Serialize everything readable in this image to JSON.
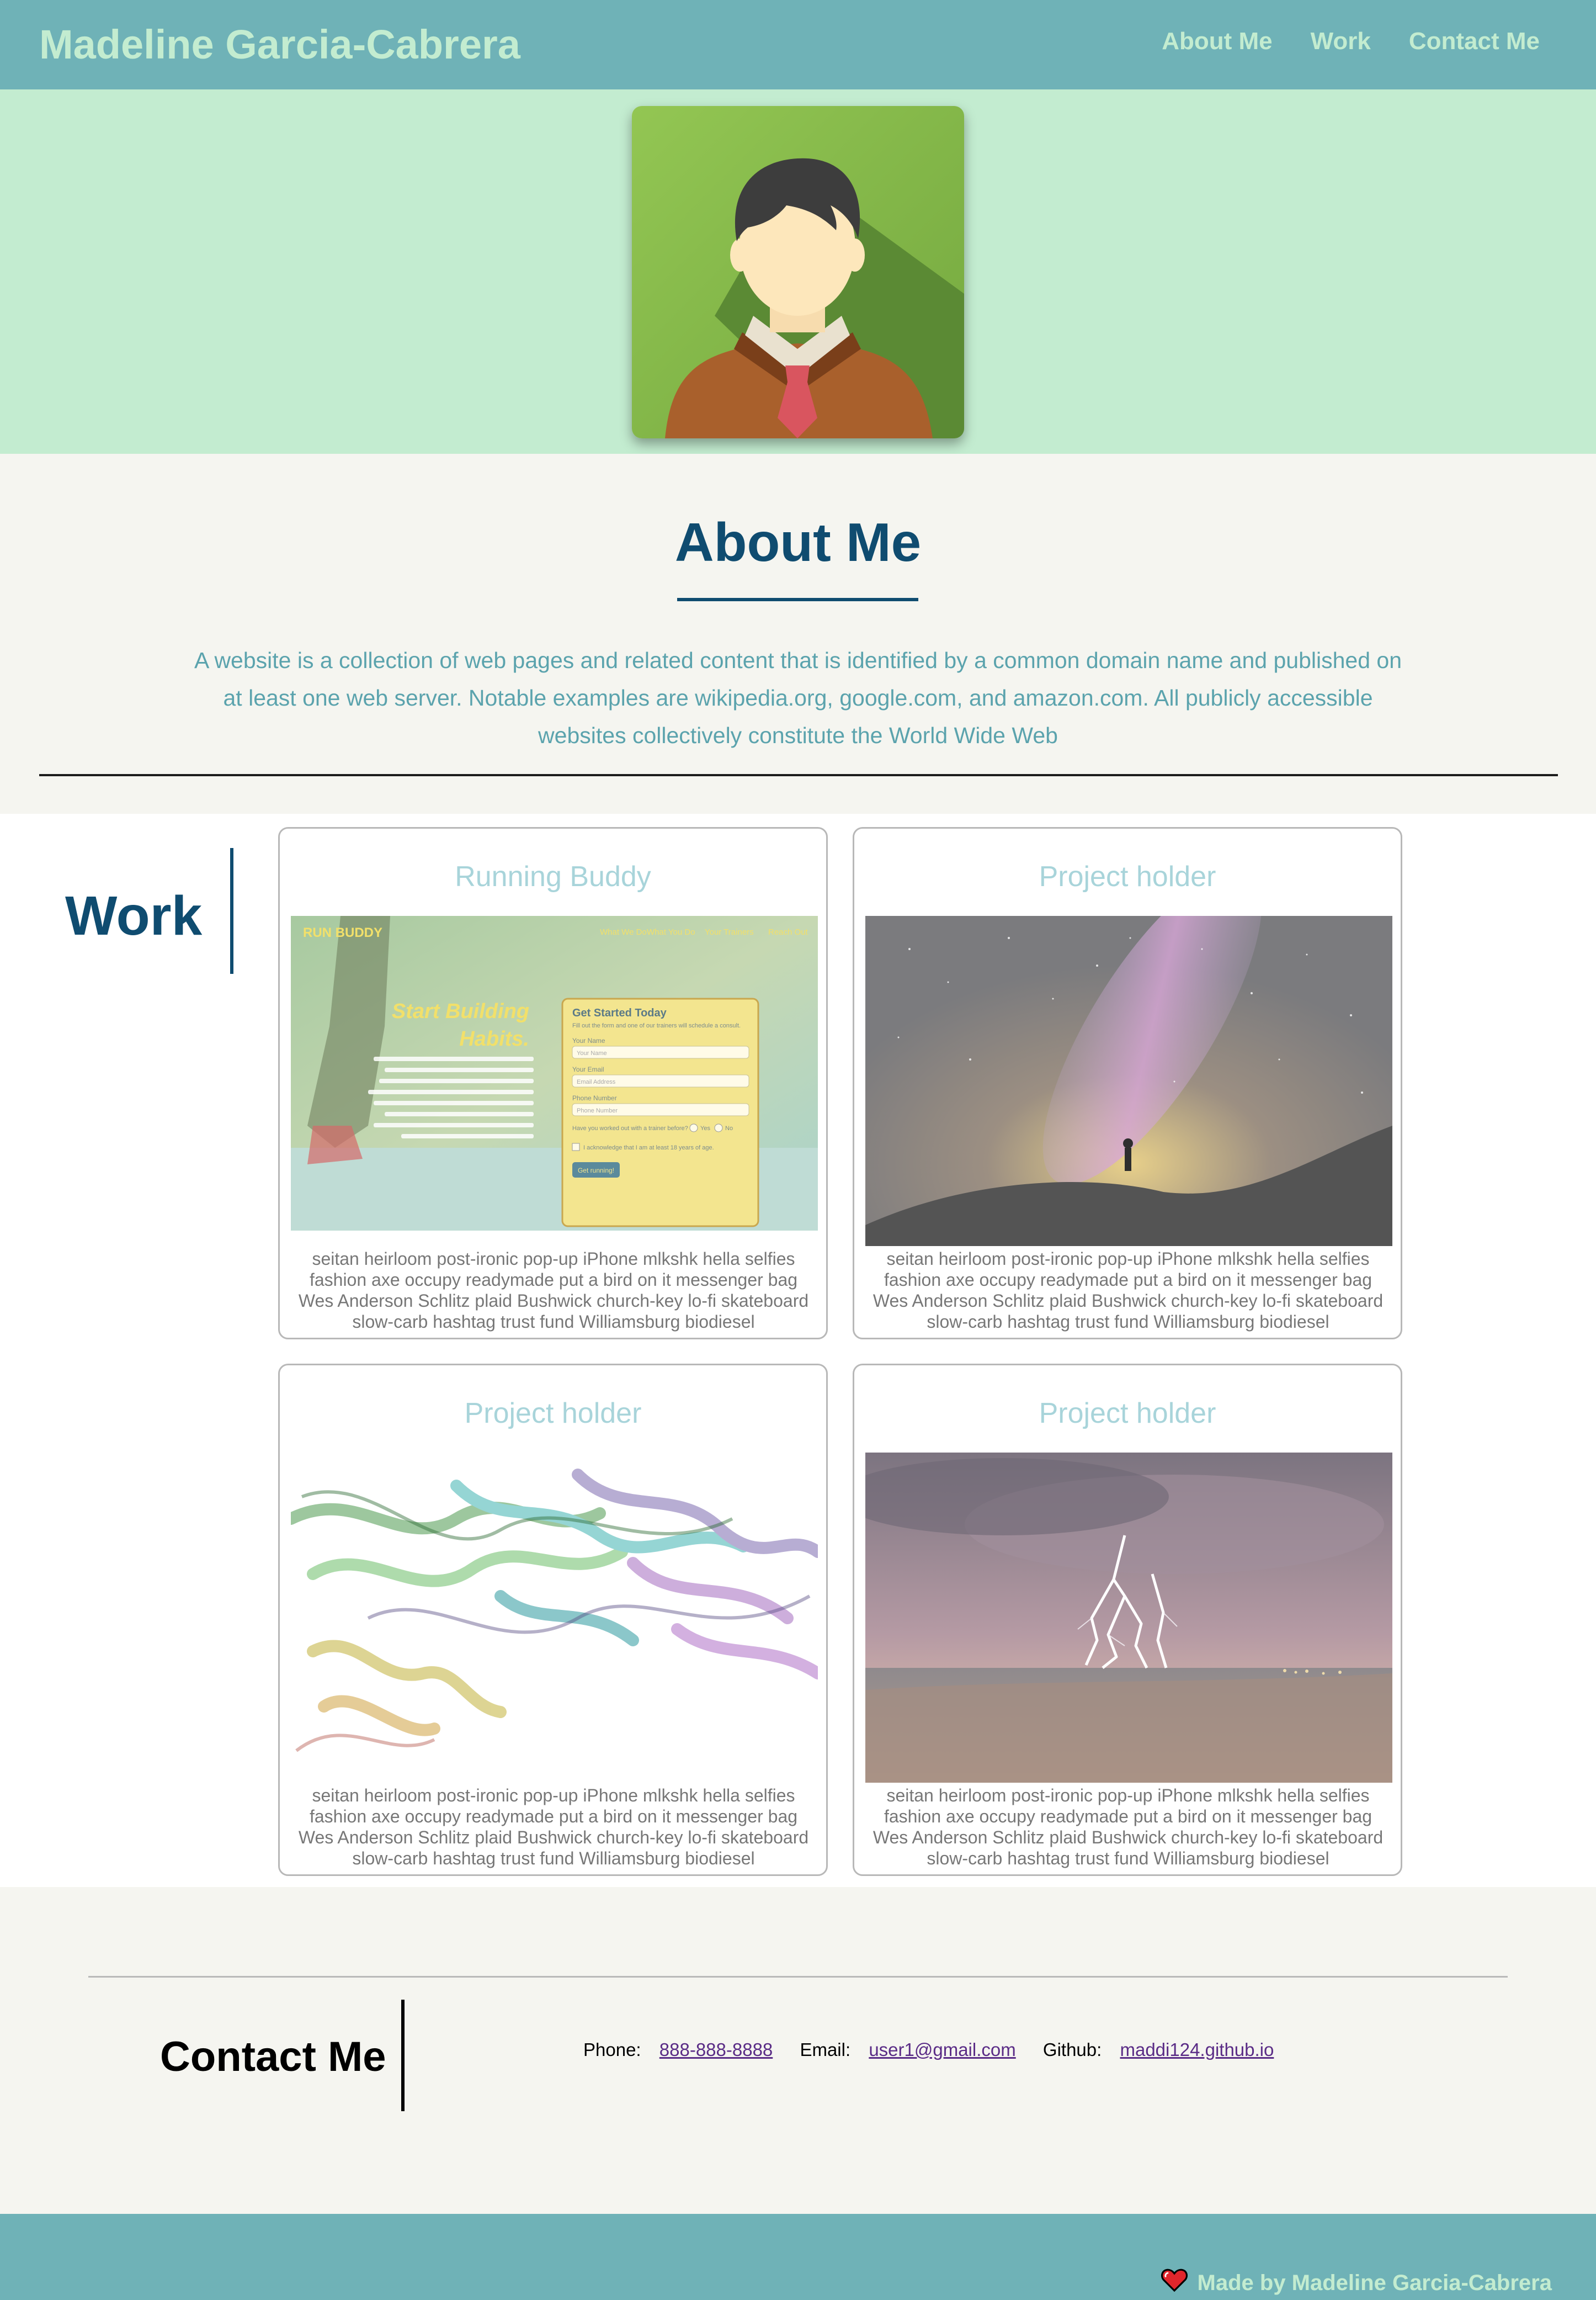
{
  "header": {
    "brand": "Madeline Garcia-Cabrera",
    "nav": [
      {
        "label": "About Me"
      },
      {
        "label": "Work"
      },
      {
        "label": "Contact Me"
      }
    ]
  },
  "about": {
    "title": "About Me",
    "text": "A website is a collection of web pages and related content that is identified by a common domain name and published on at least one web server. Notable examples are wikipedia.org, google.com, and amazon.com. All publicly accessible websites collectively constitute the World Wide Web"
  },
  "work": {
    "title": "Work",
    "cards": [
      {
        "title": "Running Buddy",
        "description": "seitan heirloom post-ironic pop-up iPhone mlkshk hella selfies fashion axe occupy readymade put a bird on it messenger bag Wes Anderson Schlitz plaid Bushwick church-key lo-fi skateboard slow-carb hashtag trust fund Williamsburg biodiesel"
      },
      {
        "title": "Project holder",
        "description": "seitan heirloom post-ironic pop-up iPhone mlkshk hella selfies fashion axe occupy readymade put a bird on it messenger bag Wes Anderson Schlitz plaid Bushwick church-key lo-fi skateboard slow-carb hashtag trust fund Williamsburg biodiesel"
      },
      {
        "title": "Project holder",
        "description": "seitan heirloom post-ironic pop-up iPhone mlkshk hella selfies fashion axe occupy readymade put a bird on it messenger bag Wes Anderson Schlitz plaid Bushwick church-key lo-fi skateboard slow-carb hashtag trust fund Williamsburg biodiesel"
      },
      {
        "title": "Project holder",
        "description": "seitan heirloom post-ironic pop-up iPhone mlkshk hella selfies fashion axe occupy readymade put a bird on it messenger bag Wes Anderson Schlitz plaid Bushwick church-key lo-fi skateboard slow-carb hashtag trust fund Williamsburg biodiesel"
      }
    ],
    "run_buddy_preview": {
      "logo": "RUN BUDDY",
      "nav": [
        "What We Do",
        "What You Do",
        "Your Trainers",
        "Reach Out"
      ],
      "headline_1": "Start Building",
      "headline_2": "Habits.",
      "form_title": "Get Started Today",
      "form_subtitle": "Fill out the form and one of our trainers will schedule a consult.",
      "field_name_label": "Your Name",
      "field_name_placeholder": "Your Name",
      "field_email_label": "Your Email",
      "field_email_placeholder": "Email Address",
      "field_phone_label": "Phone Number",
      "field_phone_placeholder": "Phone Number",
      "question": "Have you worked out with a trainer before?",
      "option_yes": "Yes",
      "option_no": "No",
      "acknowledge": "I acknowledge that I am at least 18 years of age.",
      "submit": "Get running!"
    }
  },
  "contact": {
    "title": "Contact Me",
    "phone_label": "Phone:",
    "phone": "888-888-8888",
    "email_label": "Email:",
    "email": "user1@gmail.com",
    "github_label": "Github:",
    "github": "maddi124.github.io"
  },
  "footer": {
    "credit": "Made by Madeline Garcia-Cabrera",
    "icon": "heart-icon"
  },
  "colors": {
    "header_bg": "#6fb2b7",
    "mint": "#c3ecd0",
    "navy": "#0f4c70",
    "teal_text": "#5ba3ad",
    "card_title": "#a8d4da",
    "link": "#5a2c86"
  }
}
